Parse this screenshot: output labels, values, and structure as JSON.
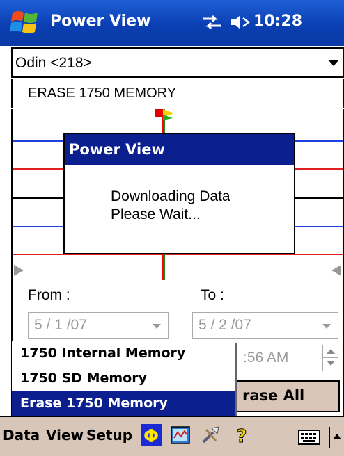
{
  "titlebar": {
    "app_title": "Power View",
    "time": "10:28"
  },
  "device": {
    "selected": "Odin <218>"
  },
  "action": {
    "label": "ERASE 1750 MEMORY"
  },
  "dialog": {
    "title": "Power View",
    "message_line1": "Downloading Data",
    "message_line2": "Please Wait..."
  },
  "form": {
    "from_label": "From :",
    "to_label": "To :",
    "from_date": "5 / 1 /07",
    "to_date": "5 / 2 /07",
    "time_value": ":56 AM",
    "erase_all_label": "rase All"
  },
  "popup_menu": {
    "items": [
      {
        "label": "1750 Internal Memory",
        "selected": false
      },
      {
        "label": "1750 SD Memory",
        "selected": false
      },
      {
        "label": "Erase 1750 Memory",
        "selected": true
      }
    ]
  },
  "menubar": {
    "data_label": "Data",
    "view_label": "View",
    "setup_label": "Setup"
  },
  "colors": {
    "title_bar": "#0a3fb3",
    "dialog_title": "#0b1f8f",
    "menu_bar": "#d8c6b8",
    "button_face": "#d9c6b8"
  },
  "icons": [
    "windows-start-icon",
    "connectivity-icon",
    "volume-icon",
    "phi-icon",
    "chart-icon",
    "tools-icon",
    "help-icon",
    "keyboard-icon"
  ]
}
